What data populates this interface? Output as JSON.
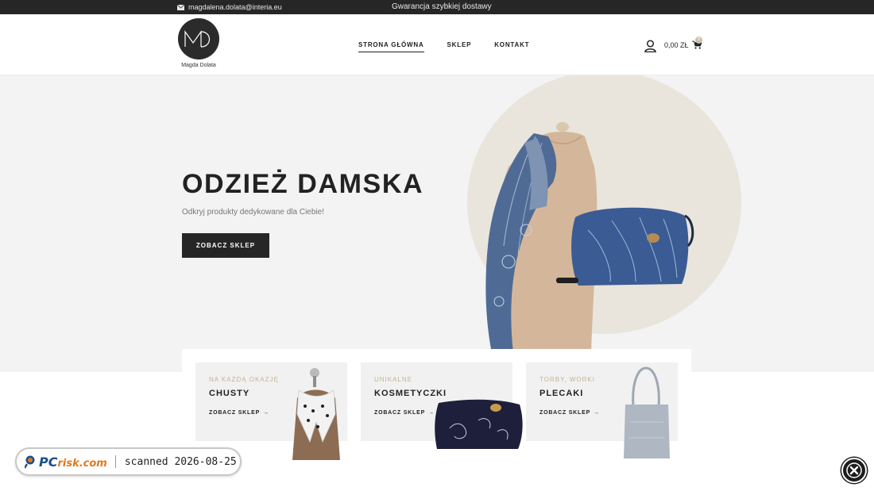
{
  "topbar": {
    "email": "magdalena.dolata@interia.eu",
    "promo": "Gwarancja szybkiej dostawy",
    "email_icon": "envelope-icon"
  },
  "header": {
    "logo_monogram": "MD",
    "logo_name": "Magda Dolata",
    "nav": [
      {
        "label": "STRONA GŁÓWNA",
        "active": true
      },
      {
        "label": "SKLEP",
        "active": false
      },
      {
        "label": "KONTAKT",
        "active": false
      }
    ],
    "cart_total": "0,00 ZŁ",
    "cart_count": "0",
    "user_icon": "user-icon",
    "cart_icon": "cart-icon"
  },
  "hero": {
    "title": "ODZIEŻ DAMSKA",
    "subtitle": "Odkryj produkty dedykowane dla Ciebie!",
    "button_label": "ZOBACZ SKLEP"
  },
  "categories": [
    {
      "tag": "NA KAŻDĄ OKAZJĘ",
      "name": "CHUSTY",
      "link": "ZOBACZ SKLEP"
    },
    {
      "tag": "UNIKALNE",
      "name": "KOSMETYCZKI",
      "link": "ZOBACZ SKLEP"
    },
    {
      "tag": "TORBY, WORKI",
      "name": "PLECAKI",
      "link": "ZOBACZ SKLEP"
    }
  ],
  "overlay": {
    "brand_pc": "PC",
    "brand_risk": "risk.com",
    "scan_text": "scanned 2026-08-25"
  },
  "colors": {
    "dark": "#262626",
    "hero_bg": "#f3f3f3",
    "circle": "#e9e5dd",
    "accent_gold": "#c2b48e"
  }
}
